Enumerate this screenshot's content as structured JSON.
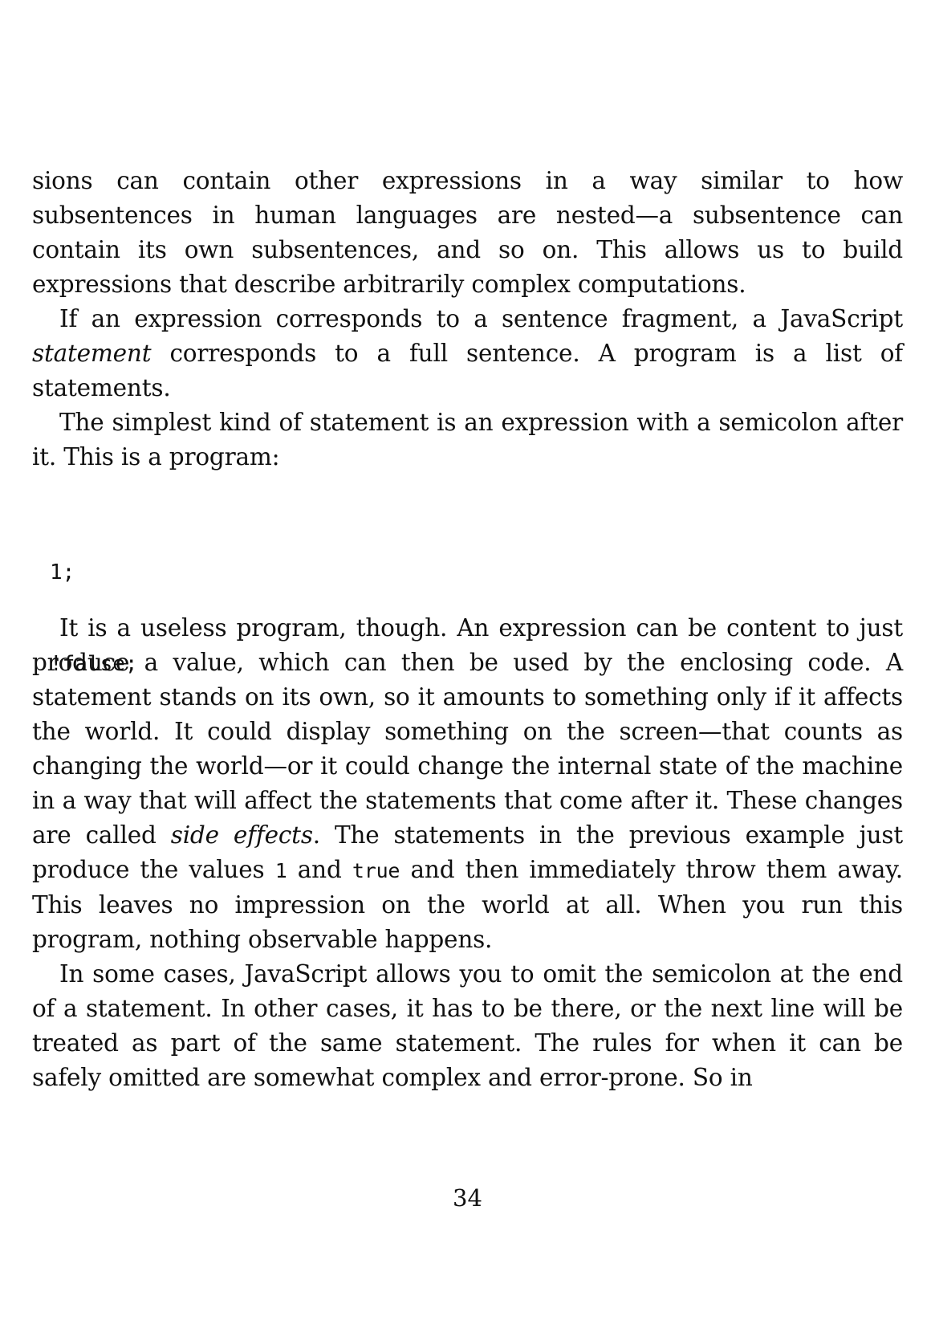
{
  "paragraphs": {
    "p1": {
      "text": "sions can contain other expressions in a way similar to how subsentences in human languages are nested—a subsentence can contain its own subsentences, and so on. This allows us to build expressions that describe arbitrarily complex computations."
    },
    "p2": {
      "before": "If an expression corresponds to a sentence fragment, a JavaScript ",
      "emph": "statement",
      "after": " corresponds to a full sentence. A program is a list of statements."
    },
    "p3": {
      "text": "The simplest kind of statement is an expression with a semicolon after it. This is a program:"
    },
    "p4": {
      "part1": "It is a useless program, though. An expression can be content to just produce a value, which can then be used by the enclosing code. A statement stands on its own, so it amounts to something only if it affects the world. It could display something on the screen—that counts as changing the world—or it could change the internal state of the machine in a way that will affect the statements that come after it. These changes are called ",
      "emph": "side effects",
      "part2": ". The statements in the previous example just produce the values ",
      "code1": "1",
      "part3": " and ",
      "code2": "true",
      "part4": " and then immediately throw them away. This leaves no impression on the world at all. When you run this program, nothing observable happens."
    },
    "p5": {
      "text": "In some cases, JavaScript allows you to omit the semicolon at the end of a statement. In other cases, it has to be there, or the next line will be treated as part of the same statement. The rules for when it can be safely omitted are somewhat complex and error-prone. So in"
    }
  },
  "code_block": {
    "lines": [
      "1;",
      "!false;"
    ]
  },
  "page_number": "34"
}
